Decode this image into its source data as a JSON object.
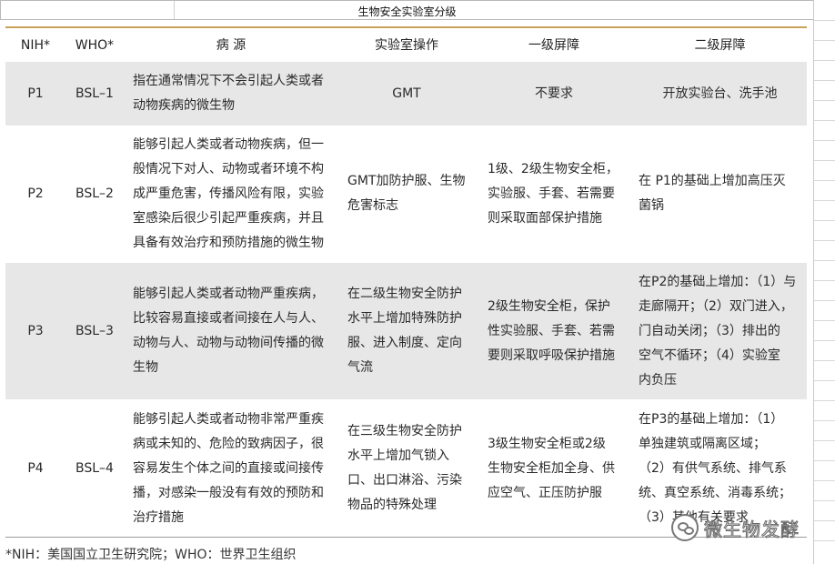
{
  "caption": "生物安全实验室分级",
  "headers": [
    "NIH*",
    "WHO*",
    "病  源",
    "实验室操作",
    "一级屏障",
    "二级屏障"
  ],
  "rows": [
    {
      "nih": "P1",
      "who": "BSL–1",
      "pathogen": "指在通常情况下不会引起人类或者\n动物疾病的微生物",
      "practice": "GMT",
      "primary": "不要求",
      "secondary": "开放实验台、洗手池"
    },
    {
      "nih": "P2",
      "who": "BSL–2",
      "pathogen": "能够引起人类或者动物疾病，但一\n般情况下对人、动物或者环境不构\n成严重危害，传播风险有限，实验\n室感染后很少引起严重疾病，并且\n具备有效治疗和预防措施的微生物",
      "practice": "GMT加防护服、生物\n危害标志",
      "primary": "1级、2级生物安全柜，\n实验服、手套、若需要\n则采取面部保护措施",
      "secondary": "在 P1的基础上增加高压灭\n菌锅"
    },
    {
      "nih": "P3",
      "who": "BSL–3",
      "pathogen": "能够引起人类或者动物严重疾病，\n比较容易直接或者间接在人与人、\n动物与人、动物与动物间传播的微\n生物",
      "practice": "在二级生物安全防护\n水平上增加特殊防护\n服、进入制度、定向\n气流",
      "primary": "2级生物安全柜，保护\n性实验服、手套、若需\n要则采取呼吸保护措施",
      "secondary": "在P2的基础上增加：（1）与\n走廊隔开；（2）双门进入，\n门自动关闭；（3）排出的\n空气不循环；（4）实验室\n内负压"
    },
    {
      "nih": "P4",
      "who": "BSL–4",
      "pathogen": "能够引起人类或者动物非常严重疾\n病或未知的、危险的致病因子，很\n容易发生个体之间的直接或间接传\n播，对感染一般没有有效的预防和\n治疗措施",
      "practice": "在三级生物安全防护\n水平上增加气锁入\n口、出口淋浴、污染\n物品的特殊处理",
      "primary": "3级生物安全柜或2级\n生物安全柜加全身、供\n应空气、正压防护服",
      "secondary": "在P3的基础上增加：（1）\n单独建筑或隔离区域；\n（2）有供气系统、排气系\n统、真空系统、消毒系统；\n（3）其他有关要求"
    }
  ],
  "footnote": "*NIH：美国国立卫生研究院；WHO：世界卫生组织",
  "watermark": "微生物发酵",
  "colors": {
    "header_rule": "#c8a256",
    "alt_row": "#e7e7e7"
  }
}
